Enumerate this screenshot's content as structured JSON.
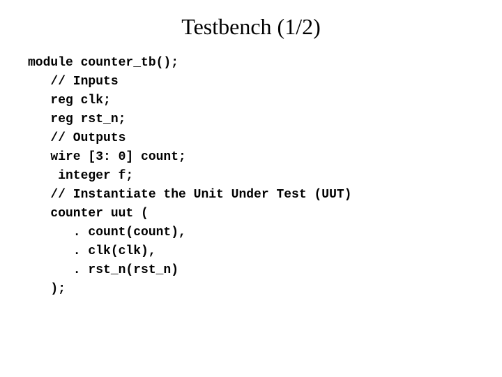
{
  "title": "Testbench (1/2)",
  "code": {
    "line1": "module counter_tb();",
    "line2": "   // Inputs",
    "line3": "   reg clk;",
    "line4": "   reg rst_n;",
    "line5": "   // Outputs",
    "line6": "   wire [3: 0] count;",
    "line7": "    integer f;",
    "line8": "   // Instantiate the Unit Under Test (UUT)",
    "line9": "   counter uut (",
    "line10": "      . count(count),",
    "line11": "      . clk(clk),",
    "line12": "      . rst_n(rst_n)",
    "line13": "   );"
  }
}
